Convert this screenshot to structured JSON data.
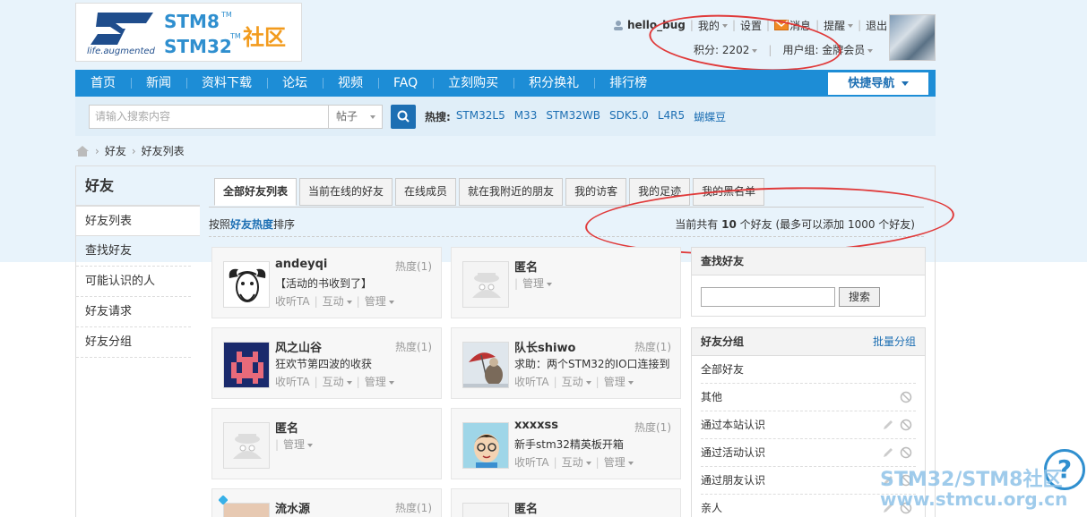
{
  "header": {
    "logo": {
      "tagline": "life.augmented",
      "line1": "STM8",
      "line2": "STM32",
      "tm": "TM",
      "community": "社区"
    },
    "user": {
      "username": "hello_bug",
      "my": "我的",
      "settings": "设置",
      "messages": "消息",
      "reminders": "提醒",
      "logout": "退出",
      "points": "积分: 2202",
      "usergroup": "用户组: 金牌会员"
    }
  },
  "nav": {
    "items": [
      "首页",
      "新闻",
      "资料下载",
      "论坛",
      "视频",
      "FAQ",
      "立刻购买",
      "积分换礼",
      "排行榜"
    ],
    "quicknav": "快捷导航"
  },
  "search": {
    "placeholder": "请输入搜索内容",
    "type": "帖子",
    "hot_label": "热搜:",
    "hot": [
      "STM32L5",
      "M33",
      "STM32WB",
      "SDK5.0",
      "L4R5",
      "蝴蝶豆"
    ]
  },
  "breadcrumb": [
    "好友",
    "好友列表"
  ],
  "sidebar": {
    "title": "好友",
    "items": [
      "好友列表",
      "查找好友",
      "可能认识的人",
      "好友请求",
      "好友分组"
    ]
  },
  "tabs": [
    "全部好友列表",
    "当前在线的好友",
    "在线成员",
    "就在我附近的朋友",
    "我的访客",
    "我的足迹",
    "我的黑名单"
  ],
  "sort": {
    "prefix": "按照",
    "key": "好友热度",
    "suffix": "排序",
    "summary_pre": "当前共有",
    "count": "10",
    "summary_post": "个好友 (最多可以添加 1000 个好友)"
  },
  "friends": [
    {
      "name": "andeyqi",
      "heat": "热度(1)",
      "msg": "【活动的书收到了】",
      "listen": "收听TA",
      "interact": "互动",
      "manage": "管理"
    },
    {
      "name": "匿名",
      "heat": "",
      "msg": "",
      "listen": "",
      "interact": "",
      "manage": "管理"
    },
    {
      "name": "风之山谷",
      "heat": "热度(1)",
      "msg": "狂欢节第四波的收获",
      "listen": "收听TA",
      "interact": "互动",
      "manage": "管理"
    },
    {
      "name": "队长shiwo",
      "heat": "热度(1)",
      "msg": "求助：两个STM32的IO口连接到",
      "listen": "收听TA",
      "interact": "互动",
      "manage": "管理"
    },
    {
      "name": "匿名",
      "heat": "",
      "msg": "",
      "listen": "",
      "interact": "",
      "manage": "管理"
    },
    {
      "name": "xxxxss",
      "heat": "热度(1)",
      "msg": "新手stm32精英板开箱",
      "listen": "收听TA",
      "interact": "互动",
      "manage": "管理"
    },
    {
      "name": "流水源",
      "heat": "热度(1)",
      "msg": "",
      "listen": "",
      "interact": "",
      "manage": ""
    },
    {
      "name": "匿名",
      "heat": "",
      "msg": "",
      "listen": "",
      "interact": "",
      "manage": ""
    }
  ],
  "find_panel": {
    "title": "查找好友",
    "button": "搜索"
  },
  "groups_panel": {
    "title": "好友分组",
    "batch": "批量分组",
    "groups": [
      "全部好友",
      "其他",
      "通过本站认识",
      "通过活动认识",
      "通过朋友认识",
      "亲人"
    ]
  },
  "watermark": {
    "line1": "STM32/STM8社区",
    "line2": "www.stmcu.org.cn"
  },
  "colors": {
    "nav": "#1d8dd6",
    "link": "#1d6fb3",
    "annotation": "#e03a3a"
  }
}
